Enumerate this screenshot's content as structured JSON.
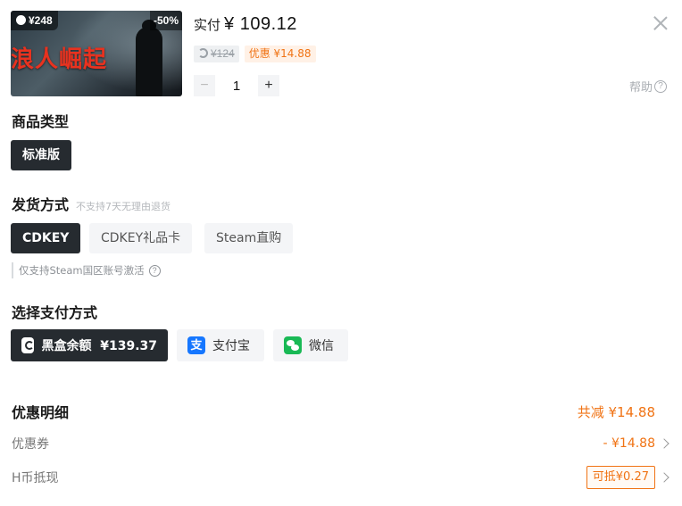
{
  "product": {
    "cover_price": "¥248",
    "cover_discount": "-50%",
    "cover_title": "浪人崛起",
    "actual_label": "实付",
    "actual_amount": "¥ 109.12",
    "original_price": "¥124",
    "coupon_tag": "优惠 ¥14.88",
    "quantity": "1",
    "minus": "−",
    "plus": "+"
  },
  "help": {
    "label": "帮助",
    "icon": "?"
  },
  "product_type": {
    "title": "商品类型",
    "options": [
      {
        "label": "标准版",
        "selected": true
      }
    ]
  },
  "delivery": {
    "title": "发货方式",
    "note": "不支持7天无理由退货",
    "options": [
      {
        "label": "CDKEY",
        "selected": true
      },
      {
        "label": "CDKEY礼品卡",
        "selected": false
      },
      {
        "label": "Steam直购",
        "selected": false
      }
    ],
    "hint": "仅支持Steam国区账号激活",
    "hint_icon": "?"
  },
  "payment": {
    "title": "选择支付方式",
    "options": [
      {
        "label": "黑盒余额  ¥139.37",
        "icon": "heybox-icon",
        "selected": true
      },
      {
        "label": "支付宝",
        "icon": "alipay-icon",
        "icon_text": "支",
        "selected": false
      },
      {
        "label": "微信",
        "icon": "wechat-icon",
        "selected": false
      }
    ]
  },
  "discount": {
    "title": "优惠明细",
    "total": "共减 ¥14.88",
    "coupon_label": "优惠券",
    "coupon_value": "- ¥14.88",
    "hcoin_label": "H币抵现",
    "hcoin_value": "可抵¥0.27"
  },
  "colors": {
    "accent": "#f07314",
    "selected_bg": "#262b30",
    "option_bg": "#f4f5f7"
  }
}
